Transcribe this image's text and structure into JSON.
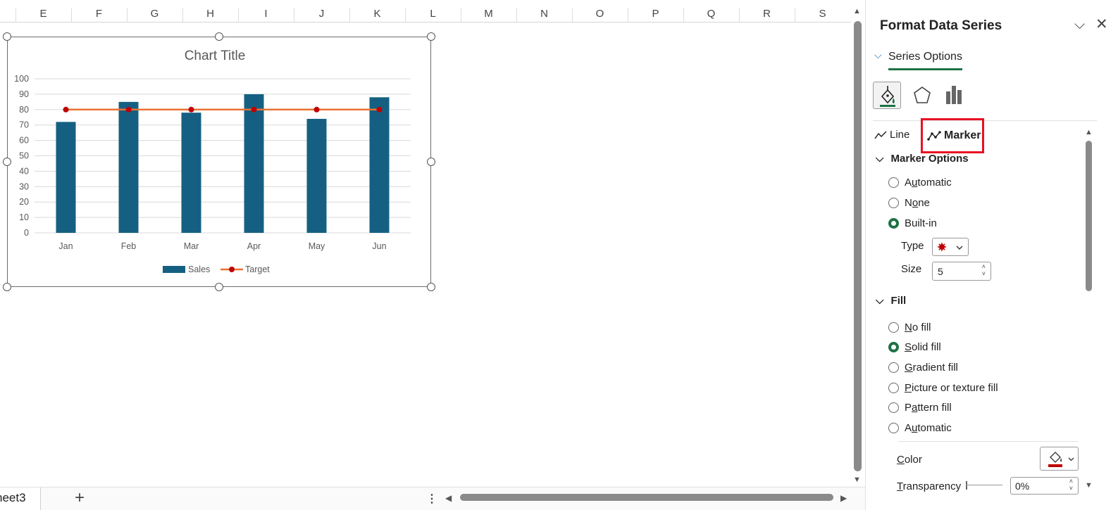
{
  "sheet": {
    "columns": [
      "E",
      "F",
      "G",
      "H",
      "I",
      "J",
      "K",
      "L",
      "M",
      "N",
      "O",
      "P",
      "Q",
      "R",
      "S"
    ],
    "active_tab": "heet3",
    "add_sheet_label": "+",
    "more_label": "⋮"
  },
  "chart_data": {
    "type": "bar",
    "title": "Chart Title",
    "categories": [
      "Jan",
      "Feb",
      "Mar",
      "Apr",
      "May",
      "Jun"
    ],
    "series": [
      {
        "name": "Sales",
        "type": "bar",
        "values": [
          72,
          85,
          78,
          90,
          74,
          88
        ],
        "color": "#156082"
      },
      {
        "name": "Target",
        "type": "line",
        "values": [
          80,
          80,
          80,
          80,
          80,
          80
        ],
        "color": "#e97132",
        "marker_color": "#c00000"
      }
    ],
    "ylim": [
      0,
      100
    ],
    "yticks": [
      "0",
      "10",
      "20",
      "30",
      "40",
      "50",
      "60",
      "70",
      "80",
      "90",
      "100"
    ],
    "grid": true,
    "legend": "bottom"
  },
  "panel": {
    "title": "Format Data Series",
    "tab_series_options": "Series Options",
    "subtab_line": "Line",
    "subtab_marker": "Marker",
    "marker_options": {
      "heading": "Marker Options",
      "opt_automatic_pre": "A",
      "opt_automatic_u": "u",
      "opt_automatic_post": "tomatic",
      "opt_none_pre": "N",
      "opt_none_u": "o",
      "opt_none_post": "ne",
      "opt_builtin": "Built-in",
      "selected": "Built-in",
      "type_label": "Type",
      "size_label": "Size",
      "size_value": "5"
    },
    "fill": {
      "heading": "Fill",
      "no_fill_u": "N",
      "no_fill_post": "o fill",
      "solid_fill_u": "S",
      "solid_fill_post": "olid fill",
      "gradient_u": "G",
      "gradient_post": "radient fill",
      "picture_u": "P",
      "picture_post": "icture or texture fill",
      "pattern_pre": "P",
      "pattern_u": "a",
      "pattern_post": "ttern fill",
      "automatic_pre": "A",
      "automatic_u": "u",
      "automatic_post": "tomatic",
      "selected": "Solid fill",
      "color_label_u": "C",
      "color_label_post": "olor",
      "transparency_label_u": "T",
      "transparency_label_post": "ransparency",
      "transparency_value": "0%",
      "color_value": "#c00000"
    }
  }
}
